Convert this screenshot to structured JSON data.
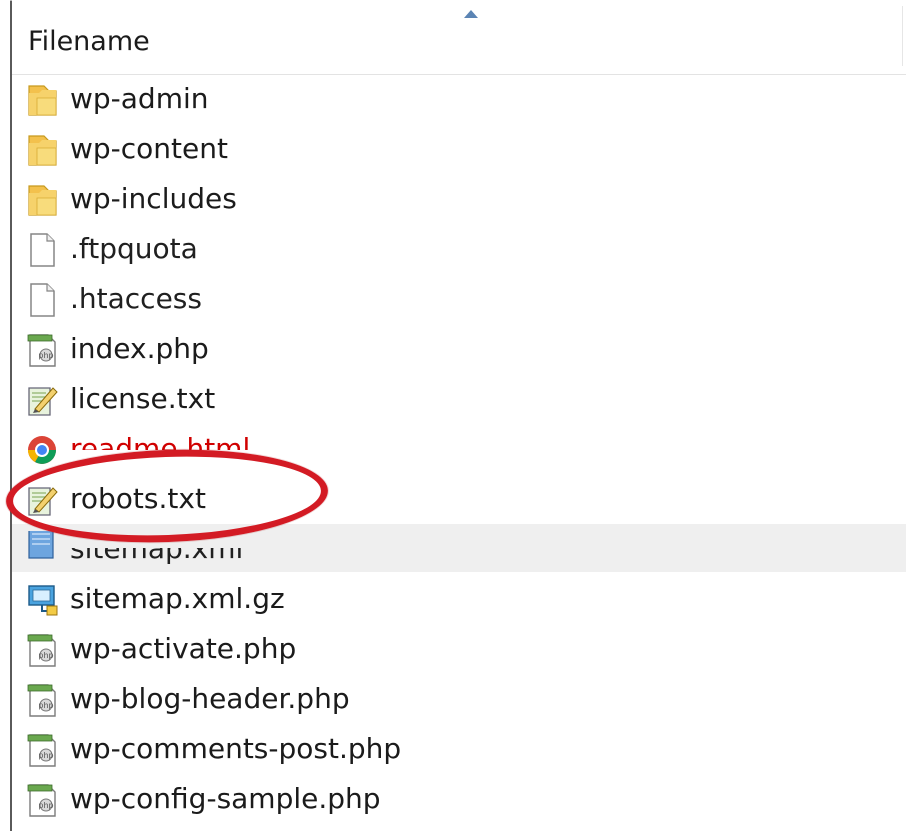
{
  "header": {
    "column_label": "Filename"
  },
  "files": [
    {
      "name": "wp-admin",
      "icon": "folder-icon"
    },
    {
      "name": "wp-content",
      "icon": "folder-icon"
    },
    {
      "name": "wp-includes",
      "icon": "folder-icon"
    },
    {
      "name": ".ftpquota",
      "icon": "file-icon"
    },
    {
      "name": ".htaccess",
      "icon": "file-icon"
    },
    {
      "name": "index.php",
      "icon": "php-file-icon"
    },
    {
      "name": "license.txt",
      "icon": "text-file-icon"
    },
    {
      "name": "readme.html",
      "icon": "chrome-html-icon"
    },
    {
      "name": "robots.txt",
      "icon": "text-file-icon"
    },
    {
      "name": "sitemap.xml",
      "icon": "xml-file-icon"
    },
    {
      "name": "sitemap.xml.gz",
      "icon": "archive-file-icon"
    },
    {
      "name": "wp-activate.php",
      "icon": "php-file-icon"
    },
    {
      "name": "wp-blog-header.php",
      "icon": "php-file-icon"
    },
    {
      "name": "wp-comments-post.php",
      "icon": "php-file-icon"
    },
    {
      "name": "wp-config-sample.php",
      "icon": "php-file-icon"
    }
  ],
  "highlight": {
    "target_file": "robots.txt",
    "color": "#d31b24"
  }
}
